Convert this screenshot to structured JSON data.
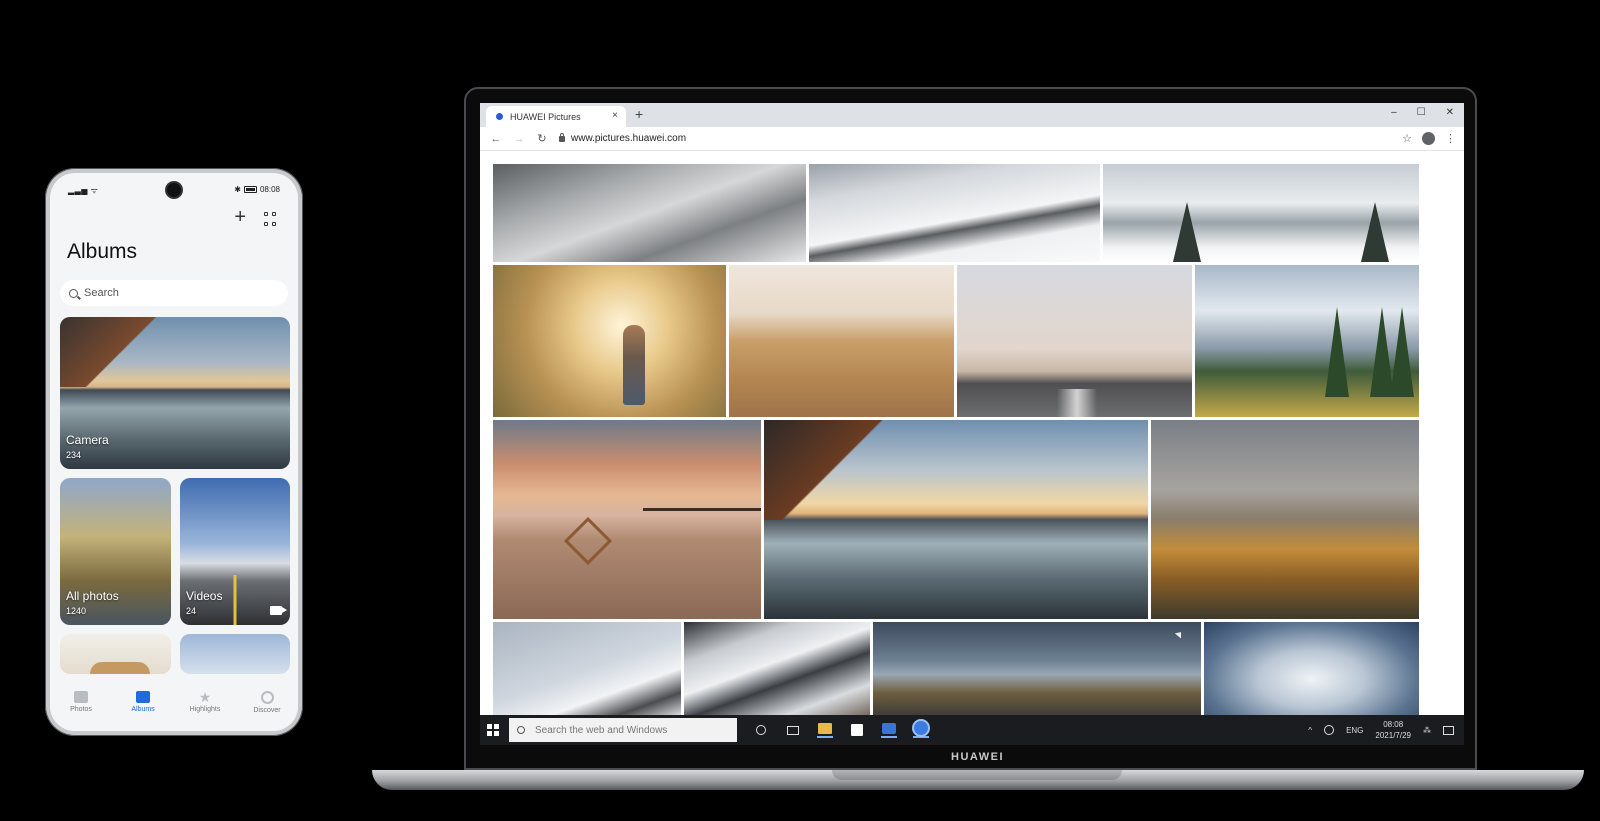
{
  "phone": {
    "status": {
      "signal": "ᴬᴬ◢",
      "time": "08:08"
    },
    "title": "Albums",
    "search": {
      "placeholder": "Search"
    },
    "albums": [
      {
        "name": "Camera",
        "count": "234"
      },
      {
        "name": "All photos",
        "count": "1240"
      },
      {
        "name": "Videos",
        "count": "24"
      }
    ],
    "nav": [
      {
        "label": "Photos",
        "icon": "photo-icon"
      },
      {
        "label": "Albums",
        "icon": "album-icon",
        "active": true
      },
      {
        "label": "Highlights",
        "icon": "star-icon"
      },
      {
        "label": "Discover",
        "icon": "discover-icon"
      }
    ],
    "accent": "#1f6ae0"
  },
  "laptop": {
    "brand": "HUAWEI",
    "browser": {
      "tab_title": "HUAWEI Pictures",
      "tab_close": "×",
      "new_tab": "+",
      "window_controls": [
        "–",
        "☐",
        "✕"
      ],
      "back": "←",
      "forward": "→",
      "reload": "↻",
      "url": "www.pictures.huawei.com",
      "bookmark": "☆",
      "menu": "⋮"
    },
    "taskbar": {
      "search_placeholder": "Search the web and Windows",
      "tray_lang": "ENG",
      "time": "08:08",
      "date": "2021/7/29",
      "chevron": "^"
    }
  }
}
